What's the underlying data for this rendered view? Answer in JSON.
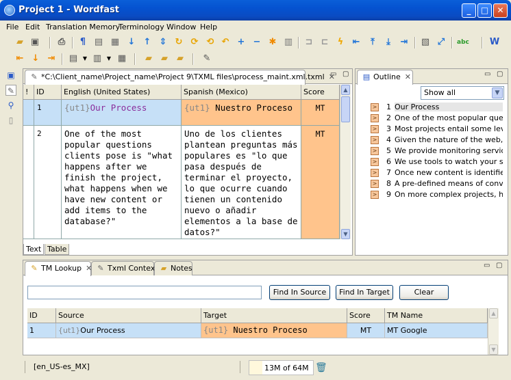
{
  "window": {
    "title": "Project 1 - Wordfast",
    "minimize": "_",
    "maximize": "□",
    "close": "✕"
  },
  "menu": [
    "File",
    "Edit",
    "Translation Memory",
    "Terminology",
    "Window",
    "Help"
  ],
  "toolbar1": [
    "open-folder-icon",
    "save-icon",
    "print-icon",
    "pilcrow-icon",
    "copy-source-icon",
    "export-icon",
    "paste-icon",
    "arrow-down-icon",
    "arrow-up-icon",
    "arrow-down-up-icon",
    "commit-icon",
    "commit-next-icon",
    "commit-all-icon",
    "undo-icon",
    "plus-icon",
    "minus-icon",
    "star-icon",
    "lock-icon",
    "segment-left-icon",
    "segment-right-icon",
    "lightning-icon",
    "first-icon",
    "top-icon",
    "bottom-icon",
    "last-icon",
    "properties-icon",
    "expand-icon",
    "spellcheck-icon",
    "word-icon"
  ],
  "toolbar2": [
    "prev-icon",
    "down-icon",
    "next-icon",
    "edit-icon",
    "split-icon",
    "view-icon",
    "folder-tm-icon",
    "folder-delete-icon",
    "folder-add-icon",
    "note-icon"
  ],
  "editor": {
    "tab_label": "*C:\\Client_name\\Project_name\\Project 9\\TXML files\\process_maint.xml.txml",
    "columns": {
      "flag": "!",
      "id": "ID",
      "source": "English (United States)",
      "target": "Spanish (Mexico)",
      "score": "Score"
    },
    "rows": [
      {
        "id": "1",
        "source_tag": "{ut1}",
        "source_text": "Our Process",
        "target_tag": "{ut1}",
        "target_text": " Nuestro Proceso",
        "score": "MT"
      },
      {
        "id": "2",
        "source_text": "One of the most popular questions clients pose is \"what happens after we finish the project, what happens when we have new content or add items to the database?\"",
        "target_text": "Uno de los clientes plantean preguntas más populares es \"lo que pasa después de terminar el proyecto, lo que ocurre cuando tienen un contenido nuevo o añadir elementos a la base de datos?\"",
        "score": "MT"
      }
    ],
    "bottom_tabs": [
      "Text",
      "Table"
    ]
  },
  "outline": {
    "tab_label": "Outline",
    "filter": "Show all",
    "items": [
      {
        "num": "1",
        "text": "Our Process"
      },
      {
        "num": "2",
        "text": "One of the most popular questi"
      },
      {
        "num": "3",
        "text": "Most projects entail some leve"
      },
      {
        "num": "4",
        "text": "Given the nature of the web, t"
      },
      {
        "num": "5",
        "text": "We provide monitoring services"
      },
      {
        "num": "6",
        "text": "We use tools to watch your sit"
      },
      {
        "num": "7",
        "text": "Once new content is identified"
      },
      {
        "num": "8",
        "text": "A pre-defined means of conveya"
      },
      {
        "num": "9",
        "text": "On more complex projects, howe"
      }
    ]
  },
  "lookup": {
    "tabs": [
      "TM Lookup",
      "Txml Context",
      "Notes"
    ],
    "search_value": "",
    "buttons": {
      "find_source": "Find In Source",
      "find_target": "Find In Target",
      "clear": "Clear"
    },
    "columns": {
      "id": "ID",
      "source": "Source",
      "target": "Target",
      "score": "Score",
      "tm_name": "TM Name"
    },
    "rows": [
      {
        "id": "1",
        "source_tag": "{ut1}",
        "source_text": "Our Process",
        "target_tag": "{ut1}",
        "target_text": " Nuestro Proceso",
        "score": "MT",
        "tm_name": "MT Google"
      }
    ]
  },
  "status": {
    "locale": "[en_US-es_MX]",
    "memory": "13M of 64M"
  },
  "colors": {
    "selected_row": "#c6e0f7",
    "match_orange": "#ffc48c",
    "tag_purple": "#8a2d9b"
  }
}
